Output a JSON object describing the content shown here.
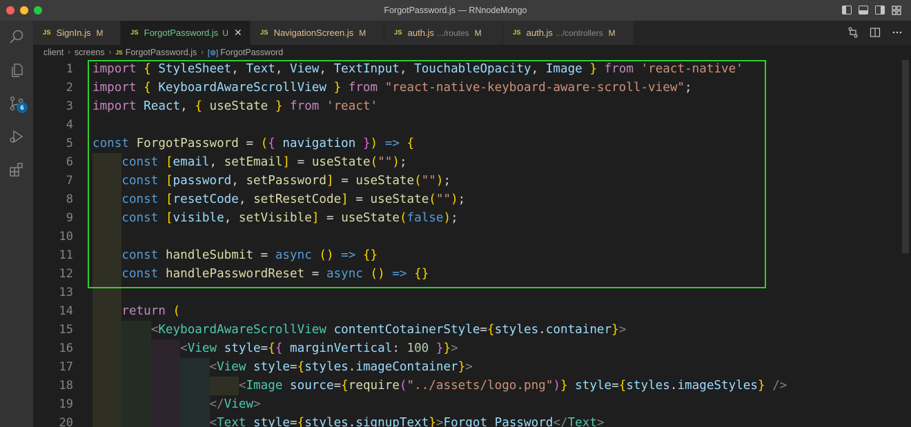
{
  "window": {
    "title": "ForgotPassword.js — RNnodeMongo"
  },
  "tabs": [
    {
      "label": "SignIn.js",
      "status": "M",
      "path": ""
    },
    {
      "label": "ForgotPassword.js",
      "status": "U",
      "path": "",
      "active": true
    },
    {
      "label": "NavigationScreen.js",
      "status": "M",
      "path": ""
    },
    {
      "label": "auth.js",
      "status": "M",
      "path": ".../routes"
    },
    {
      "label": "auth.js",
      "status": "M",
      "path": ".../controllers"
    }
  ],
  "breadcrumb": [
    "client",
    "screens",
    "ForgotPassword.js",
    "ForgotPassword"
  ],
  "source_control_badge": "6",
  "line_numbers": [
    "1",
    "2",
    "3",
    "4",
    "5",
    "6",
    "7",
    "8",
    "9",
    "10",
    "11",
    "12",
    "13",
    "14",
    "15",
    "16",
    "17",
    "18",
    "19",
    "20"
  ],
  "code_lines": [
    "import { StyleSheet, Text, View, TextInput, TouchableOpacity, Image } from 'react-native'",
    "import { KeyboardAwareScrollView } from \"react-native-keyboard-aware-scroll-view\";",
    "import React, { useState } from 'react'",
    "",
    "const ForgotPassword = ({ navigation }) => {",
    "    const [email, setEmail] = useState(\"\");",
    "    const [password, setPassword] = useState(\"\");",
    "    const [resetCode, setResetCode] = useState(\"\");",
    "    const [visible, setVisible] = useState(false);",
    "",
    "    const handleSubmit = async () => {}",
    "    const handlePasswordReset = async () => {}",
    "",
    "    return (",
    "        <KeyboardAwareScrollView contentCotainerStyle={styles.container}>",
    "            <View style={{ marginVertical: 100 }}>",
    "                <View style={styles.imageContainer}>",
    "                    <Image source={require(\"../assets/logo.png\")} style={styles.imageStyles} />",
    "                </View>",
    "                <Text style={styles.signupText}>Forgot Password</Text>"
  ],
  "colors": {
    "highlight_border": "#2dd12d",
    "modified": "#e2c08d",
    "untracked": "#73c991"
  }
}
